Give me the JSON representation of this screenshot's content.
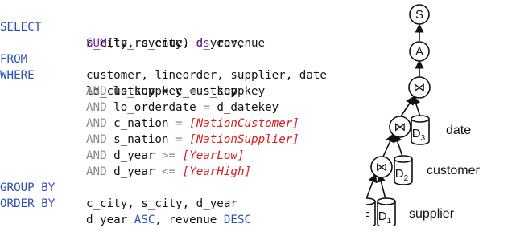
{
  "query": {
    "select": {
      "keyword": "SELECT",
      "cols": "c_city, s_city, d_year,",
      "agg_fn": "SUM",
      "agg_arg": "(lo_revenue)",
      "alias_kw": "as",
      "alias": "revenue"
    },
    "from": {
      "keyword": "FROM",
      "tables": "customer, lineorder, supplier, date"
    },
    "where": {
      "keyword": "WHERE",
      "first": "lo_custkey = c_custkey",
      "conditions": [
        {
          "and": "AND",
          "lhs": "lo_suppkey",
          "op": "=",
          "rhs": "s_suppkey"
        },
        {
          "and": "AND",
          "lhs": "lo_orderdate",
          "op": "=",
          "rhs": "d_datekey"
        },
        {
          "and": "AND",
          "lhs": "c_nation",
          "op": "=",
          "param": "[NationCustomer]"
        },
        {
          "and": "AND",
          "lhs": "s_nation",
          "op": "=",
          "param": "[NationSupplier]"
        },
        {
          "and": "AND",
          "lhs": "d_year",
          "op": ">=",
          "param": "[YearLow]"
        },
        {
          "and": "AND",
          "lhs": "d_year",
          "op": "<=",
          "param": "[YearHigh]"
        }
      ]
    },
    "group_by": {
      "keyword": "GROUP BY",
      "cols": "c_city, s_city, d_year"
    },
    "order_by": {
      "keyword": "ORDER BY",
      "col1": "d_year",
      "dir1": "ASC",
      "col2": "revenue",
      "dir2": "DESC"
    }
  },
  "plan": {
    "nodes": {
      "sink": "S",
      "aggregate": "A",
      "join": "⋈",
      "fact": "F",
      "d1": "D",
      "d1_sub": "1",
      "d2": "D",
      "d2_sub": "2",
      "d3": "D",
      "d3_sub": "3"
    },
    "labels": {
      "d3": "date",
      "d2": "customer",
      "d1": "supplier"
    }
  }
}
